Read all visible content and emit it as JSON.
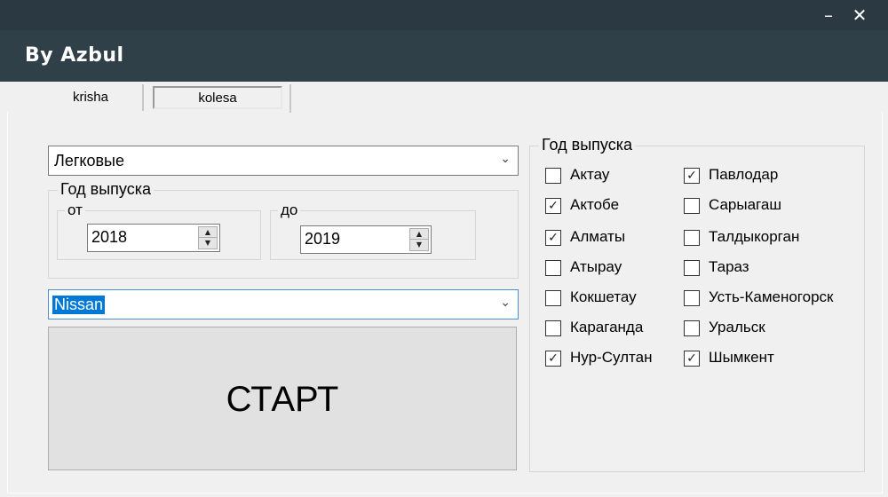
{
  "window": {
    "title": "By Azbul",
    "minimize_glyph": "–",
    "close_glyph": "✕"
  },
  "tabs": [
    {
      "label": "krisha",
      "selected": false
    },
    {
      "label": "kolesa",
      "selected": true
    }
  ],
  "form": {
    "vehicle_type": "Легковые",
    "year_group_label": "Год выпуска",
    "from_label": "от",
    "from_value": "2018",
    "to_label": "до",
    "to_value": "2019",
    "brand": "Nissan",
    "start_label": "СТАРТ"
  },
  "cities": {
    "group_label": "Год выпуска",
    "left_column": [
      {
        "name": "Актау",
        "checked": false
      },
      {
        "name": "Актобе",
        "checked": true
      },
      {
        "name": "Алматы",
        "checked": true
      },
      {
        "name": "Атырау",
        "checked": false
      },
      {
        "name": "Кокшетау",
        "checked": false
      },
      {
        "name": "Караганда",
        "checked": false
      },
      {
        "name": "Нур-Султан",
        "checked": true
      }
    ],
    "right_column": [
      {
        "name": "Павлодар",
        "checked": true
      },
      {
        "name": "Сарыагаш",
        "checked": false
      },
      {
        "name": "Талдыкорган",
        "checked": false
      },
      {
        "name": "Тараз",
        "checked": false
      },
      {
        "name": "Усть-Каменогорск",
        "checked": false
      },
      {
        "name": "Уральск",
        "checked": false
      },
      {
        "name": "Шымкент",
        "checked": true
      }
    ]
  },
  "icons": {
    "chevron": "chevron-down-icon",
    "checkmark": "checkmark-icon",
    "spin_up": "triangle-up-icon",
    "spin_down": "triangle-down-icon"
  },
  "colors": {
    "titlebar": "#2b3a42",
    "header": "#2f4049",
    "selection": "#0078d7"
  }
}
